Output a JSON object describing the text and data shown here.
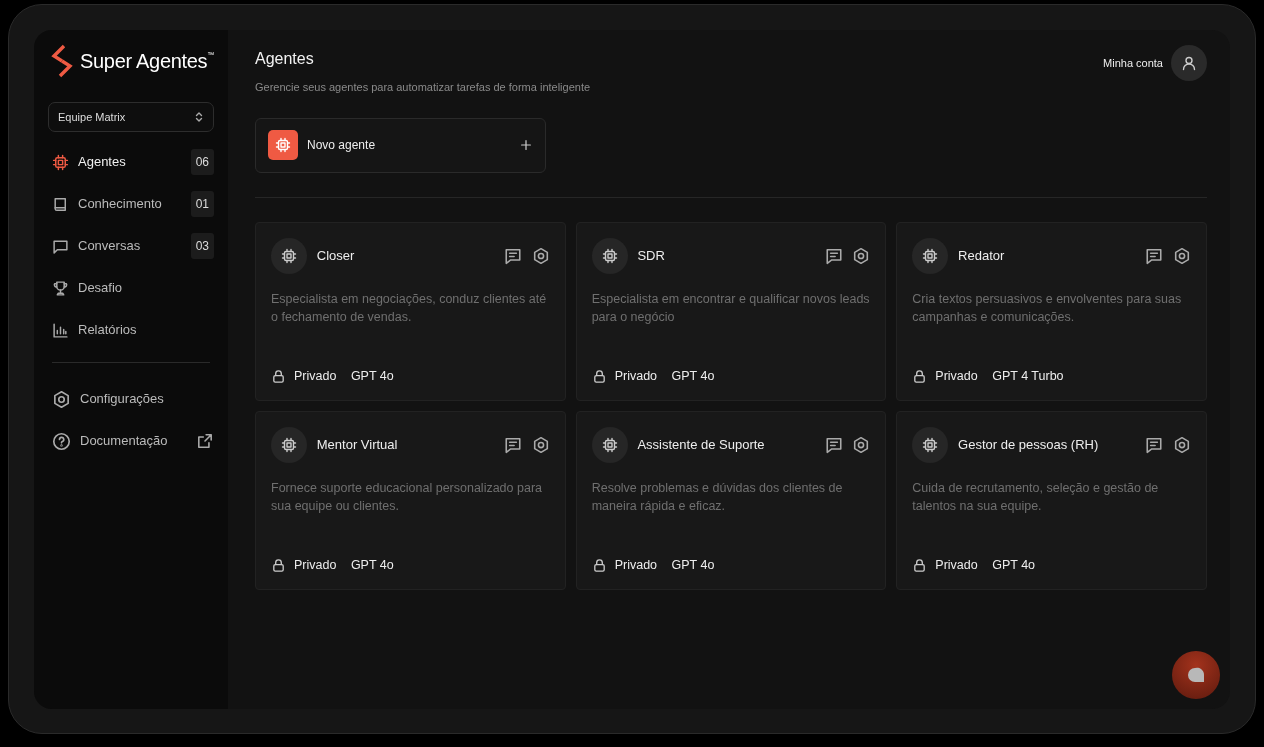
{
  "brand": {
    "name": "Super Agentes$^{™}$"
  },
  "team_select": {
    "value": "Equipe Matrix"
  },
  "nav": [
    {
      "label": "Agentes",
      "count": "06",
      "selected": true
    },
    {
      "label": "Conhecimento",
      "count": "01",
      "selected": false
    },
    {
      "label": "Conversas",
      "count": "03",
      "selected": false
    },
    {
      "label": "Desafio",
      "selected": false
    },
    {
      "label": "Relatórios",
      "selected": false
    }
  ],
  "nav_footer": [
    {
      "label": "Configurações",
      "external": false
    },
    {
      "label": "Documentação",
      "external": true
    }
  ],
  "header": {
    "title": "Agentes",
    "subtitle": "Gerencie seus agentes para automatizar tarefas de forma inteligente",
    "account": "Minha conta"
  },
  "new_agent": {
    "label": "Novo agente"
  },
  "agents": [
    {
      "name": "Closer",
      "description": "Especialista em negociações, conduz clientes até o fechamento de vendas.",
      "visibility": "Privado",
      "model": "GPT 4o"
    },
    {
      "name": "SDR",
      "description": "Especialista em encontrar e qualificar novos leads para o negócio",
      "visibility": "Privado",
      "model": "GPT 4o"
    },
    {
      "name": "Redator",
      "description": "Cria textos persuasivos e envolventes para suas campanhas e comunicações.",
      "visibility": "Privado",
      "model": "GPT 4 Turbo"
    },
    {
      "name": "Mentor Virtual",
      "description": "Fornece suporte educacional personalizado para sua equipe ou clientes.",
      "visibility": "Privado",
      "model": "GPT 4o"
    },
    {
      "name": "Assistente de Suporte",
      "description": "Resolve problemas e dúvidas dos clientes de maneira rápida e eficaz.",
      "visibility": "Privado",
      "model": "GPT 4o"
    },
    {
      "name": "Gestor de pessoas (RH)",
      "description": "Cuida de recrutamento, seleção e gestão de talentos na sua equipe.",
      "visibility": "Privado",
      "model": "GPT 4o"
    }
  ]
}
